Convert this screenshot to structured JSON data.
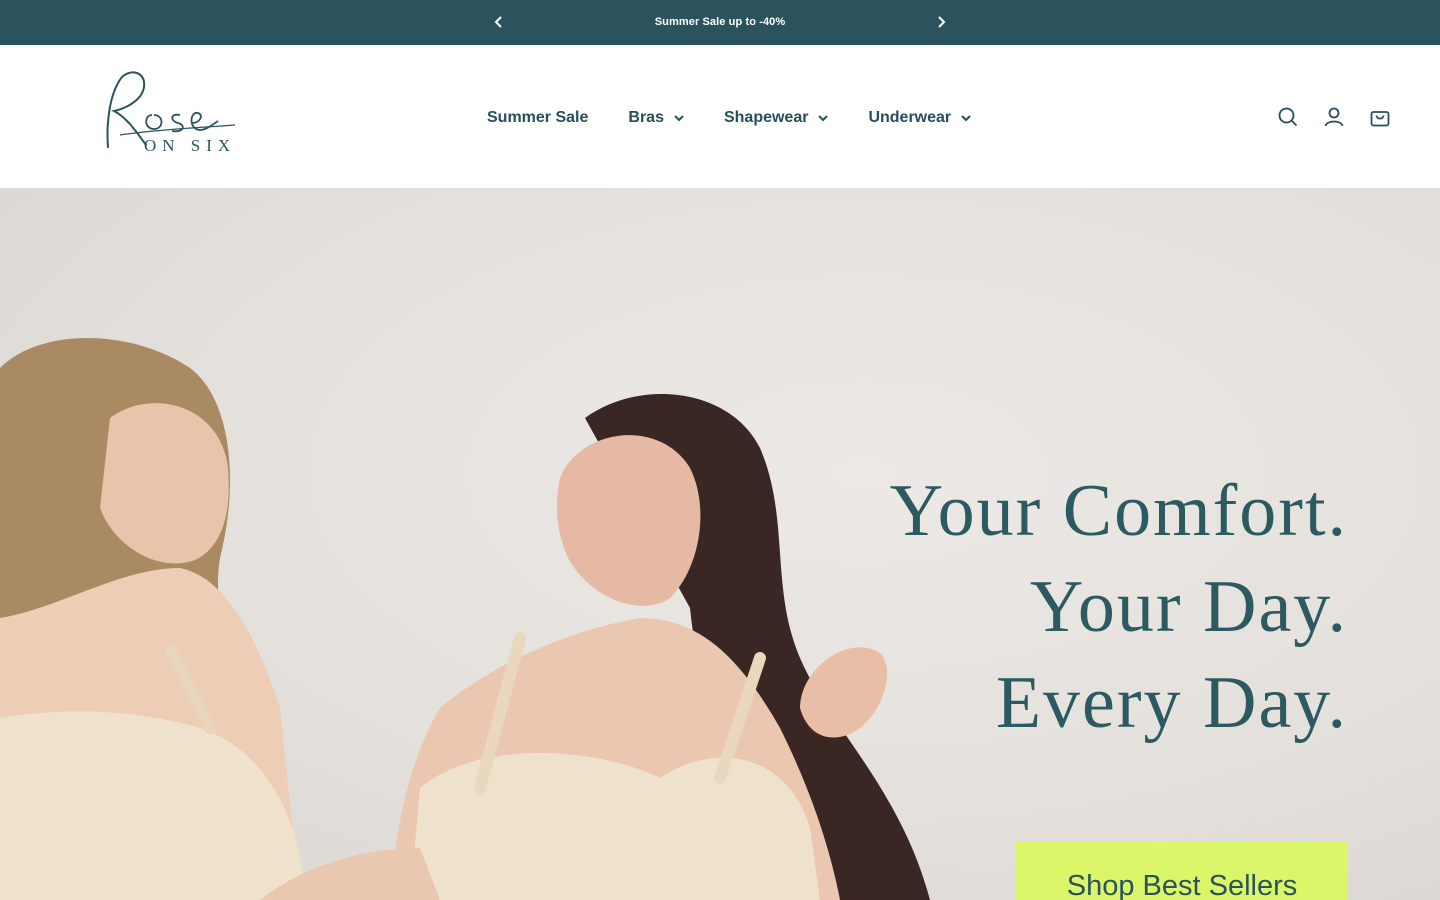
{
  "announcement": {
    "message": "Summer Sale up to -40%",
    "prev_icon": "chevron-left-icon",
    "next_icon": "chevron-right-icon",
    "background": "#2b535d"
  },
  "header": {
    "logo": {
      "script_text": "Rose",
      "sub_text": "ON SIX"
    },
    "nav": [
      {
        "label": "Summer Sale",
        "dropdown": false
      },
      {
        "label": "Bras",
        "dropdown": true
      },
      {
        "label": "Shapewear",
        "dropdown": true
      },
      {
        "label": "Underwear",
        "dropdown": true
      }
    ],
    "icons": [
      "search-icon",
      "account-icon",
      "cart-icon"
    ]
  },
  "hero": {
    "headline": [
      "Your Comfort.",
      "Your Day.",
      "Every Day."
    ],
    "cta_label": "Shop Best Sellers",
    "cta_color": "#dcf66a",
    "text_color": "#2b5a61"
  }
}
